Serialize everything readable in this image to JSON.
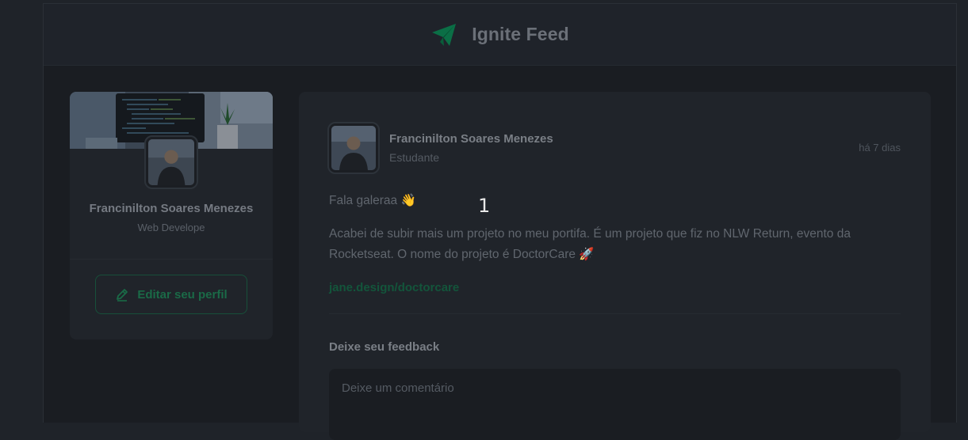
{
  "header": {
    "title": "Ignite Feed",
    "logo_icon": "paper-plane-icon",
    "accent_color": "#0b6f46"
  },
  "sidebar": {
    "name": "Francinilton Soares Menezes",
    "role": "Web Develope",
    "edit_button_label": "Editar seu perfil",
    "edit_icon": "pencil-icon"
  },
  "post": {
    "author_name": "Francinilton Soares Menezes",
    "author_role": "Estudante",
    "time": "há 7 dias",
    "greeting": "Fala galeraa 👋",
    "body": "Acabei de subir mais um projeto no meu portifa. É um projeto que fiz no NLW Return, evento da Rocketseat. O nome do projeto é DoctorCare 🚀",
    "link": "jane.design/doctorcare",
    "feedback_title": "Deixe seu feedback",
    "comment_placeholder": "Deixe um comentário",
    "comment_value": ""
  },
  "overlay": {
    "marker_label": "1"
  }
}
